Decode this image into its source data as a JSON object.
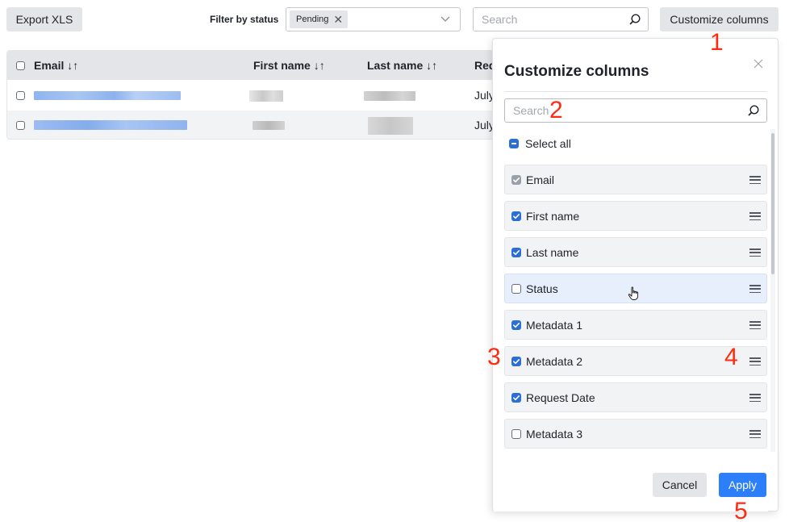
{
  "toolbar": {
    "export_label": "Export XLS",
    "filter_label": "Filter by status",
    "filter_tag": "Pending",
    "search_placeholder": "Search",
    "customize_label": "Customize columns"
  },
  "table": {
    "headers": {
      "email": "Email ↓↑",
      "first_name": "First name ↓↑",
      "last_name": "Last name ↓↑",
      "request": "Req"
    },
    "rows": [
      {
        "date": "July"
      },
      {
        "date": "July"
      }
    ]
  },
  "panel": {
    "title": "Customize columns",
    "search_placeholder": "Search",
    "select_all": "Select all",
    "columns": [
      {
        "label": "Email",
        "state": "locked"
      },
      {
        "label": "First name",
        "state": "checked"
      },
      {
        "label": "Last name",
        "state": "checked"
      },
      {
        "label": "Status",
        "state": "unchecked"
      },
      {
        "label": "Metadata 1",
        "state": "checked"
      },
      {
        "label": "Metadata 2",
        "state": "checked"
      },
      {
        "label": "Request Date",
        "state": "checked"
      },
      {
        "label": "Metadata 3",
        "state": "unchecked"
      }
    ],
    "cancel_label": "Cancel",
    "apply_label": "Apply"
  },
  "annotations": [
    "1",
    "2",
    "3",
    "4",
    "5"
  ],
  "colors": {
    "accent": "#2d7ff9",
    "annotation": "#ff2a10",
    "checkbox_on": "#2b6fd6",
    "hover_row": "#e6effb"
  },
  "icons": [
    "search-icon",
    "chevron-down-icon",
    "close-icon",
    "drag-handle-icon",
    "pointer-cursor-icon",
    "checkmark-icon"
  ]
}
